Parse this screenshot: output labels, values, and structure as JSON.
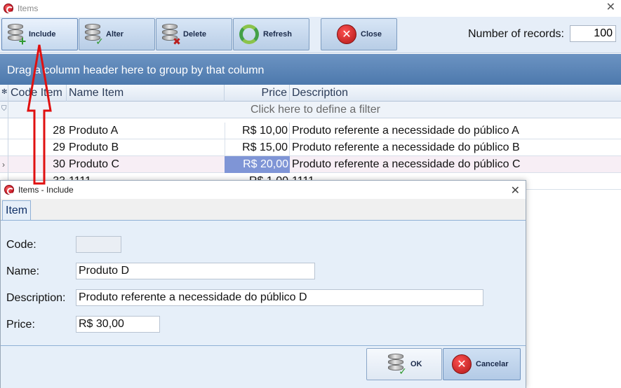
{
  "main_window": {
    "title": "Items",
    "toolbar": {
      "include_label": "Include",
      "alter_label": "Alter",
      "delete_label": "Delete",
      "refresh_label": "Refresh",
      "close_label": "Close",
      "records_label": "Number of records:",
      "records_value": "100"
    },
    "group_panel_text": "Drag a column header here to group by that column",
    "grid": {
      "columns": [
        "Code Item",
        "Name Item",
        "Price",
        "Description"
      ],
      "filter_text": "Click here to define a filter",
      "rows": [
        {
          "code": "28",
          "name": "Produto A",
          "price": "R$ 10,00",
          "description": "Produto referente a necessidade do público A"
        },
        {
          "code": "29",
          "name": "Produto B",
          "price": "R$ 15,00",
          "description": "Produto referente a necessidade do público B"
        },
        {
          "code": "30",
          "name": "Produto C",
          "price": "R$ 20,00",
          "description": "Produto referente a necessidade do público C"
        },
        {
          "code": "33",
          "name": "1111",
          "price": "R$ 1,00",
          "description": "1111"
        }
      ]
    }
  },
  "dialog": {
    "title": "Items - Include",
    "tab_label": "Item",
    "fields": {
      "code_label": "Code:",
      "code_value": "",
      "name_label": "Name:",
      "name_value": "Produto D",
      "description_label": "Description:",
      "description_value": "Produto referente a necessidade do público D",
      "price_label": "Price:",
      "price_value": "R$ 30,00"
    },
    "ok_label": "OK",
    "cancel_label": "Cancelar"
  },
  "colors": {
    "group_panel": "#5b84b7",
    "selected_price": "#7f95d6",
    "annotation_arrow": "#e01010"
  }
}
